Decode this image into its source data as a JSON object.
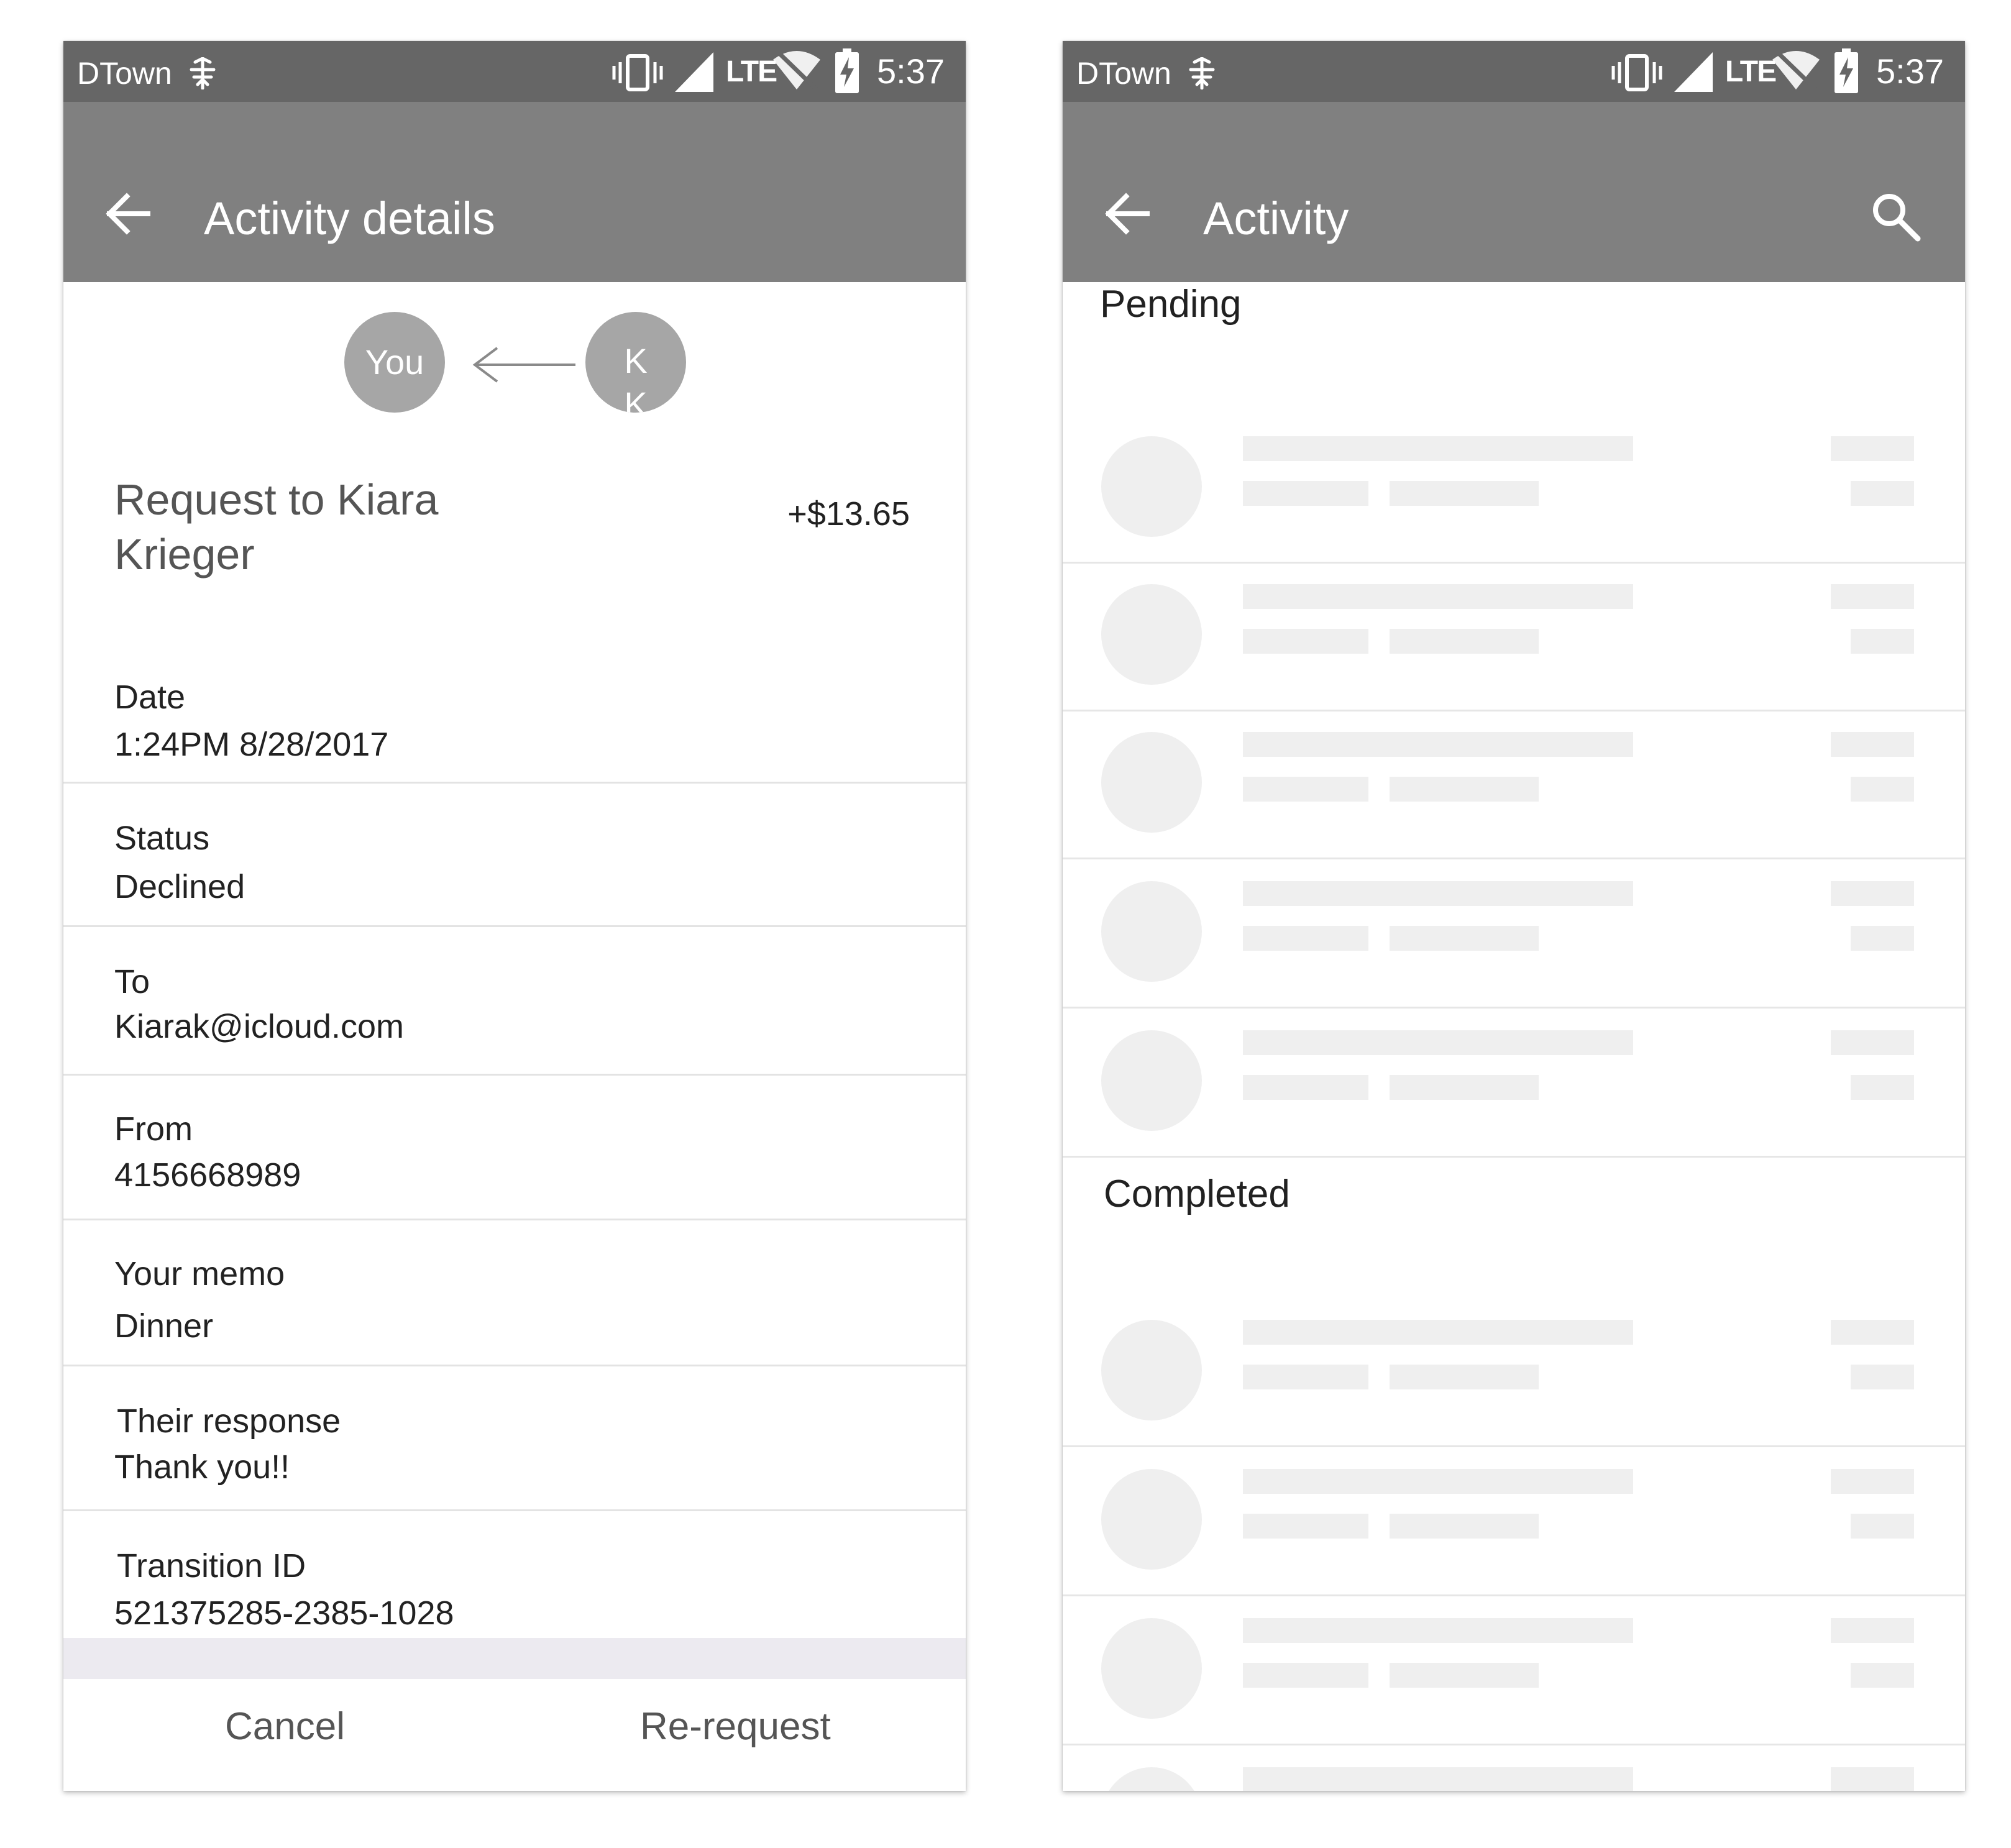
{
  "status_bar": {
    "carrier": "DTown",
    "time": "5:37",
    "network_label": "LTE"
  },
  "details_screen": {
    "app_bar": {
      "title": "Activity details"
    },
    "avatars": {
      "you": "You",
      "other_line1": "K",
      "other_line2": "K"
    },
    "request_title": "Request to Kiara Krieger",
    "amount": "+$13.65",
    "fields": [
      {
        "label": "Date",
        "value": "1:24PM 8/28/2017"
      },
      {
        "label": "Status",
        "value": "Declined"
      },
      {
        "label": "To",
        "value": "Kiarak@icloud.com"
      },
      {
        "label": "From",
        "value": "4156668989"
      },
      {
        "label": "Your memo",
        "value": "Dinner"
      },
      {
        "label": "Their response",
        "value": "Thank you!!"
      },
      {
        "label": "Transition ID",
        "value": "521375285-2385-1028"
      }
    ],
    "actions": {
      "cancel": "Cancel",
      "rerequest": "Re-request"
    }
  },
  "activity_screen": {
    "app_bar": {
      "title": "Activity"
    },
    "sections": {
      "pending": "Pending",
      "completed": "Completed"
    }
  },
  "colors": {
    "status_bar": "#666666",
    "app_bar": "#808080",
    "avatar": "#a6a6a6",
    "skeleton": "#efefef"
  },
  "icons": [
    "back-arrow-icon",
    "search-icon",
    "vibrate-icon",
    "signal-icon",
    "wifi-off-icon",
    "battery-charging-icon",
    "carrier-tower-icon",
    "request-arrow-icon"
  ]
}
